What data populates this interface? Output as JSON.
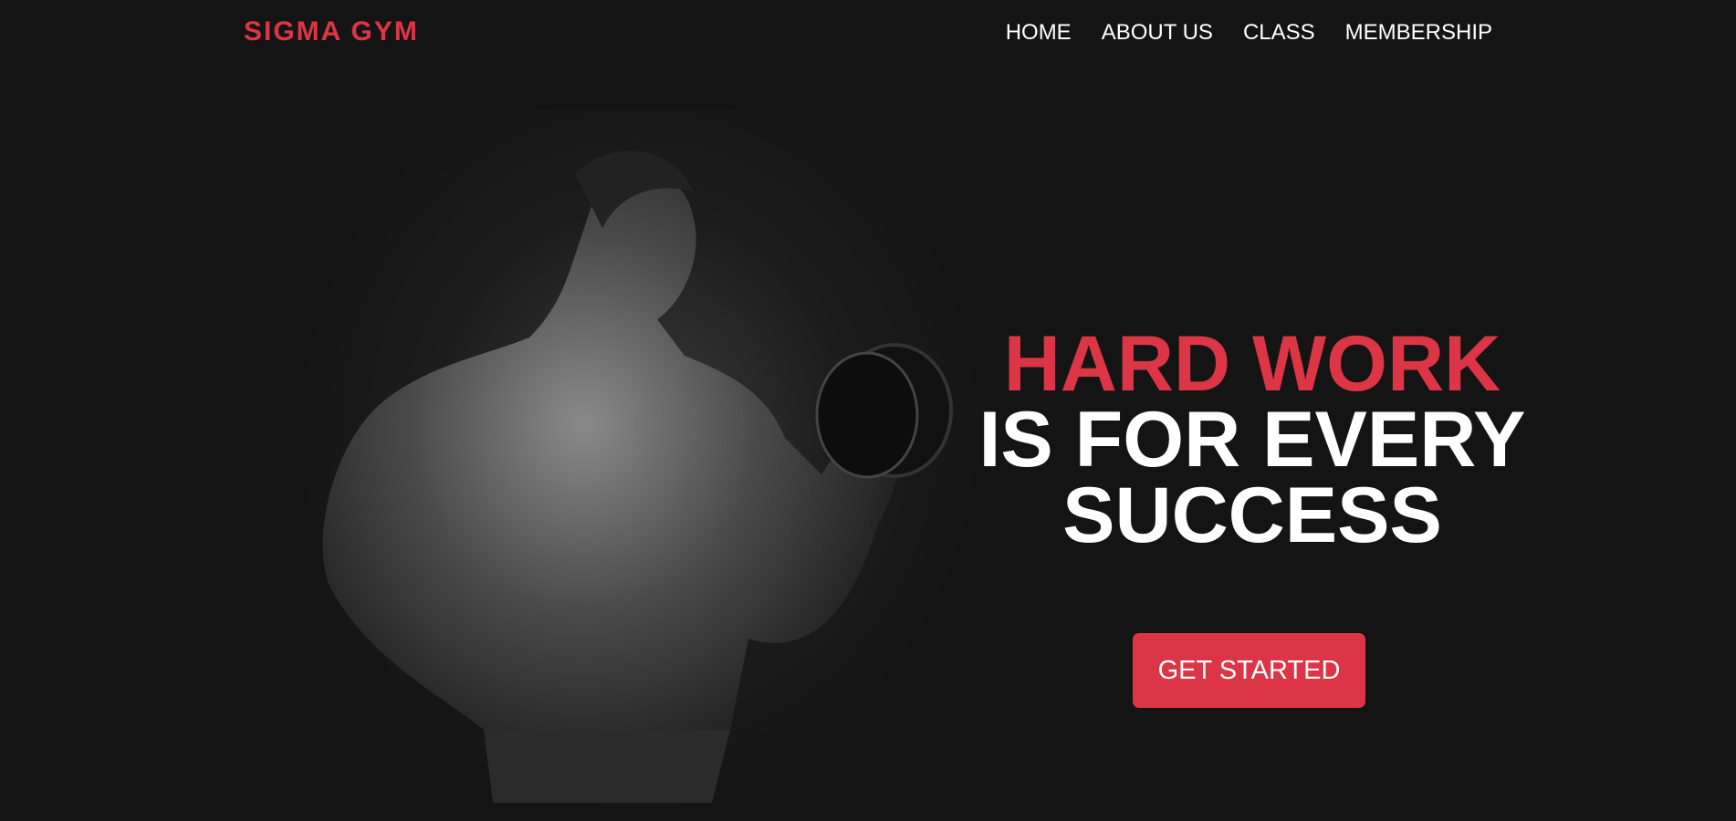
{
  "brand": {
    "name": "SIGMA GYM",
    "accent": "#dc3545"
  },
  "nav": {
    "items": [
      {
        "label": "HOME"
      },
      {
        "label": "ABOUT US"
      },
      {
        "label": "CLASS"
      },
      {
        "label": "MEMBERSHIP"
      }
    ]
  },
  "hero": {
    "line1": "HARD WORK",
    "line2": "IS FOR EVERY",
    "line3": "SUCCESS",
    "cta": "GET STARTED"
  }
}
